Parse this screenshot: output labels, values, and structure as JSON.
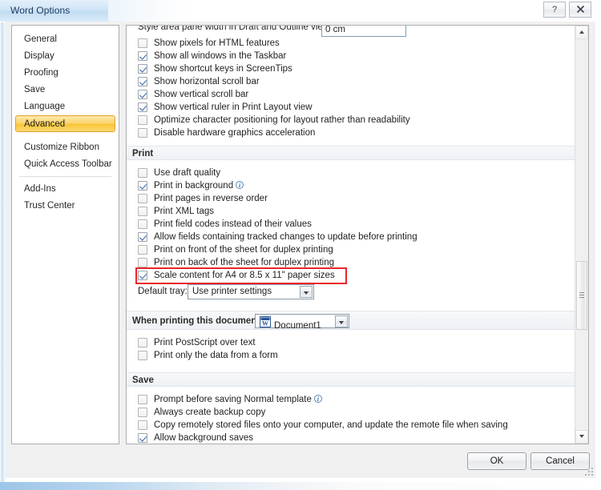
{
  "window": {
    "title": "Word Options",
    "help_icon": "question-mark-icon",
    "close_icon": "close-icon"
  },
  "sidebar": {
    "items": [
      {
        "label": "General",
        "selected": false
      },
      {
        "label": "Display",
        "selected": false
      },
      {
        "label": "Proofing",
        "selected": false
      },
      {
        "label": "Save",
        "selected": false
      },
      {
        "label": "Language",
        "selected": false
      },
      {
        "label": "Advanced",
        "selected": true
      },
      {
        "label": "Customize Ribbon",
        "selected": false
      },
      {
        "label": "Quick Access Toolbar",
        "selected": false
      },
      {
        "label": "Add-Ins",
        "selected": false
      },
      {
        "label": "Trust Center",
        "selected": false
      }
    ]
  },
  "content": {
    "clipped_row": {
      "label": "Style area pane width in Draft and Outline views:",
      "value": "0 cm"
    },
    "display_options": [
      {
        "label": "Show pixels for HTML features",
        "checked": false,
        "accel": "x"
      },
      {
        "label": "Show all windows in the Taskbar",
        "checked": true,
        "accel": "w"
      },
      {
        "label": "Show shortcut keys in ScreenTips",
        "checked": true,
        "accel": "h"
      },
      {
        "label": "Show horizontal scroll bar",
        "checked": true,
        "accel": "z"
      },
      {
        "label": "Show vertical scroll bar",
        "checked": true,
        "accel": "v"
      },
      {
        "label": "Show vertical ruler in Print Layout view",
        "checked": true,
        "accel": "c"
      },
      {
        "label": "Optimize character positioning for layout rather than readability",
        "checked": false,
        "accel": ""
      },
      {
        "label": "Disable hardware graphics acceleration",
        "checked": false,
        "accel": "g"
      }
    ],
    "print_section": {
      "header": "Print",
      "options": [
        {
          "label": "Use draft quality",
          "checked": false,
          "accel": "q",
          "info": false,
          "highlighted": false
        },
        {
          "label": "Print in background",
          "checked": true,
          "accel": "b",
          "info": true,
          "highlighted": false
        },
        {
          "label": "Print pages in reverse order",
          "checked": false,
          "accel": "r",
          "info": false,
          "highlighted": false
        },
        {
          "label": "Print XML tags",
          "checked": false,
          "accel": "X",
          "info": false,
          "highlighted": false
        },
        {
          "label": "Print field codes instead of their values",
          "checked": false,
          "accel": "f",
          "info": false,
          "highlighted": false
        },
        {
          "label": "Allow fields containing tracked changes to update before printing",
          "checked": true,
          "accel": "t",
          "info": false,
          "highlighted": false
        },
        {
          "label": "Print on front of the sheet for duplex printing",
          "checked": false,
          "accel": "r",
          "info": false,
          "highlighted": false
        },
        {
          "label": "Print on back of the sheet for duplex printing",
          "checked": false,
          "accel": "a",
          "info": false,
          "highlighted": false
        },
        {
          "label": "Scale content for A4 or 8.5 x 11\" paper sizes",
          "checked": true,
          "accel": "A",
          "info": false,
          "highlighted": true
        }
      ],
      "default_tray": {
        "label": "Default tray:",
        "value": "Use printer settings",
        "arrow_icon": "chevron-down-icon"
      }
    },
    "when_printing": {
      "label": "When printing this document:",
      "document_value": "Document1",
      "document_icon": "word-document-icon",
      "arrow_icon": "chevron-down-icon",
      "options": [
        {
          "label": "Print PostScript over text",
          "checked": false,
          "accel": "P"
        },
        {
          "label": "Print only the data from a form",
          "checked": false,
          "accel": "d"
        }
      ]
    },
    "save_section": {
      "header": "Save",
      "options": [
        {
          "label": "Prompt before saving Normal template",
          "checked": false,
          "accel": "o",
          "info": true
        },
        {
          "label": "Always create backup copy",
          "checked": false,
          "accel": "b",
          "info": false
        },
        {
          "label": "Copy remotely stored files onto your computer, and update the remote file when saving",
          "checked": false,
          "accel": "e",
          "info": false
        },
        {
          "label": "Allow background saves",
          "checked": true,
          "accel": "",
          "info": false
        }
      ]
    }
  },
  "scrollbar": {
    "up_icon": "scroll-up-arrow-icon",
    "down_icon": "scroll-down-arrow-icon",
    "thumb_position_percent": 56
  },
  "footer": {
    "ok_label": "OK",
    "cancel_label": "Cancel"
  },
  "colors": {
    "accent_selected": "#f8c537",
    "highlight_box": "#e8262a",
    "title_text": "#1c3c62",
    "info_icon": "#3d6fa5"
  }
}
